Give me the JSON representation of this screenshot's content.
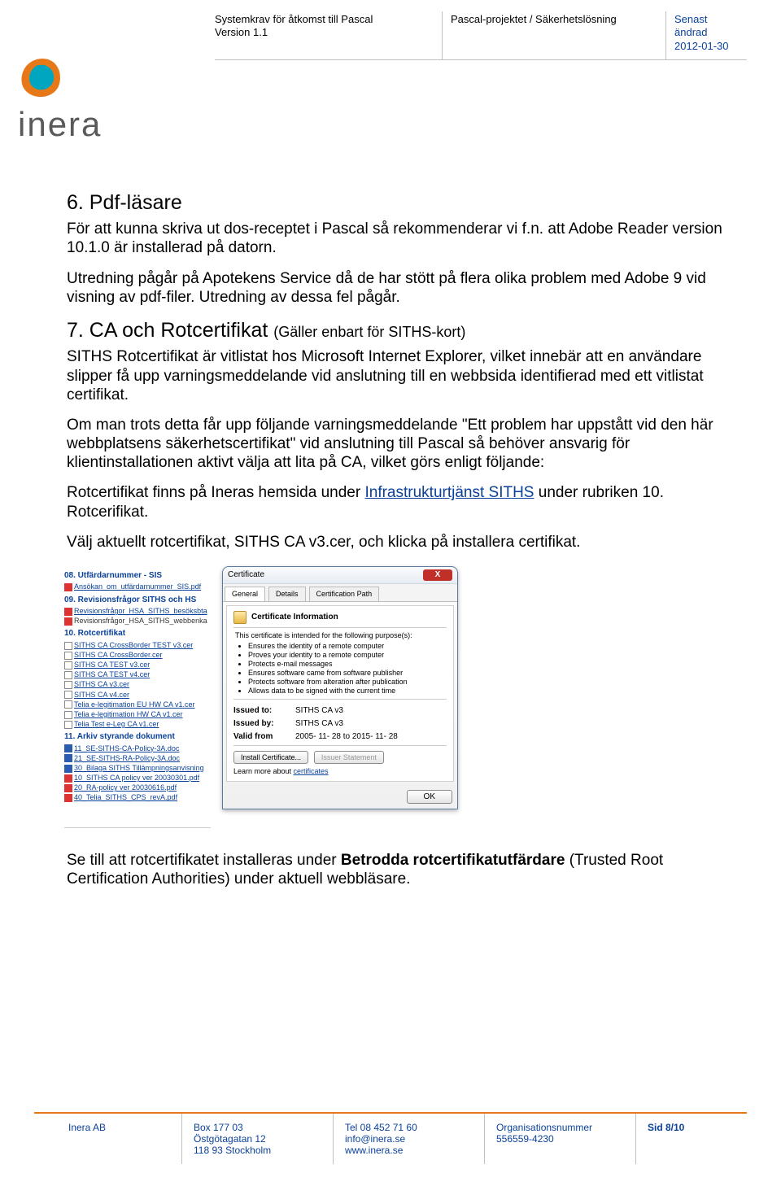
{
  "header": {
    "col1_line1": "Systemkrav för åtkomst till Pascal",
    "col1_line2": "Version 1.1",
    "col2": "Pascal-projektet / Säkerhetslösning",
    "col3_line1": "Senast ändrad",
    "col3_line2": "2012-01-30"
  },
  "logo": {
    "text": "inera"
  },
  "section6": {
    "heading": "6.   Pdf-läsare",
    "p1a": "För att kunna skriva ut dos-receptet i Pascal så rekommenderar vi f.n. att Adobe Reader version 10.1.0 är installerad på datorn.",
    "p1b": "Utredning pågår på Apotekens Service då de har stött på flera olika problem med Adobe 9 vid visning av pdf-filer. Utredning av dessa fel pågår."
  },
  "section7": {
    "heading_num": "7.   CA och Rotcertifikat ",
    "heading_sub": "(Gäller enbart för SITHS-kort)",
    "p1": "SITHS Rotcertifikat är vitlistat hos Microsoft Internet Explorer, vilket innebär att en användare slipper få upp varningsmeddelande vid anslutning till en webbsida identifierad med ett vitlistat certifikat.",
    "p2": "Om man trots detta får upp följande varningsmeddelande \"Ett problem har uppstått vid den här webbplatsens säkerhetscertifikat\" vid anslutning till Pascal så behöver ansvarig för klientinstallationen aktivt välja att lita på CA, vilket görs enligt följande:",
    "p3_pre": "Rotcertifikat finns på Ineras hemsida under ",
    "p3_link": "Infrastrukturtjänst SITHS",
    "p3_post": " under rubriken 10. Rotcerifikat.",
    "p4": "Välj aktuellt rotcertifikat, SITHS CA v3.cer, och klicka på installera certifikat."
  },
  "embedded": {
    "s08_h": "08. Utfärdarnummer - SIS",
    "s08_1": "Ansökan_om_utfärdarnummer_SIS.pdf",
    "s09_h": "09. Revisionsfrågor SITHS och HS",
    "s09_1": "Revisionsfrågor_HSA_SITHS_besöksbta",
    "s09_2": "Revisionsfrågor_HSA_SITHS_webbenka",
    "s10_h": "10. Rotcertifikat",
    "s10": [
      "SITHS CA CrossBorder TEST v3.cer",
      "SITHS CA CrossBorder.cer",
      "SITHS CA TEST v3.cer",
      "SITHS CA TEST v4.cer",
      "SITHS CA v3.cer",
      "SITHS CA v4.cer",
      "Telia e-legitimation EU HW CA v1.cer",
      "Telia e-legitimation HW CA v1.cer",
      "Telia Test e-Leg CA v1.cer"
    ],
    "s11_h": "11. Arkiv styrande dokument",
    "s11": [
      "11_SE-SITHS-CA-Policy-3A.doc",
      "21_SE-SITHS-RA-Policy-3A.doc",
      "30_Bilaga SITHS Tillämpningsanvisning",
      "10_SITHS CA policy ver 20030301.pdf",
      "20_RA-policy ver 20030616.pdf",
      "40_Telia_SITHS_CPS_revA.pdf"
    ],
    "cert": {
      "title": "Certificate",
      "tab1": "General",
      "tab2": "Details",
      "tab3": "Certification Path",
      "info_h": "Certificate Information",
      "intended": "This certificate is intended for the following purpose(s):",
      "purposes": [
        "Ensures the identity of a remote computer",
        "Proves your identity to a remote computer",
        "Protects e-mail messages",
        "Ensures software came from software publisher",
        "Protects software from alteration after publication",
        "Allows data to be signed with the current time"
      ],
      "issued_to_l": "Issued to:",
      "issued_to_v": "SITHS CA v3",
      "issued_by_l": "Issued by:",
      "issued_by_v": "SITHS CA v3",
      "valid_l": "Valid from",
      "valid_v": "2005- 11- 28  to  2015- 11- 28",
      "btn_install": "Install Certificate...",
      "btn_issuer": "Issuer Statement",
      "learn_pre": "Learn more about ",
      "learn_link": "certificates",
      "ok": "OK"
    }
  },
  "trailer": {
    "pre": "Se till att rotcertifikatet installeras under ",
    "bold": "Betrodda rotcertifikatutfärdare",
    "post": " (Trusted Root Certification Authorities) under aktuell webbläsare."
  },
  "footer": {
    "company": "Inera AB",
    "addr1": "Box 177 03",
    "addr2": "Östgötagatan 12",
    "addr3": "118 93 Stockholm",
    "tel": "Tel 08 452 71 60",
    "mail": "info@inera.se",
    "web": "www.inera.se",
    "orgl": "Organisationsnummer",
    "orgv": "556559-4230",
    "page": "Sid 8/10"
  }
}
